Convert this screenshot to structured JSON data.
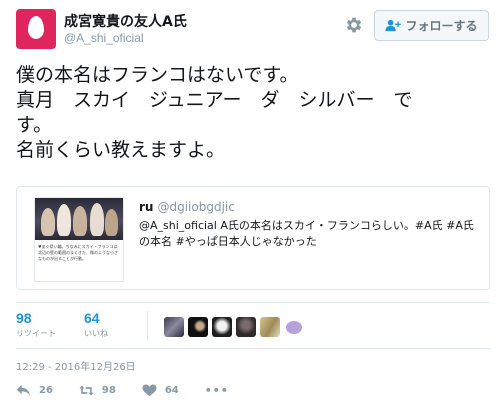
{
  "author": {
    "display_name": "成宮寛貴の友人A氏",
    "screen_name": "@A_shi_oficial",
    "avatar_color": "#e0245e"
  },
  "follow_button": {
    "label": "フォローする"
  },
  "tweet": {
    "lines": [
      "僕の本名はフランコはないです。",
      "真月　スカイ　ジュニアー　ダ　シルバー　で",
      "す。",
      "名前くらい教えますよ。"
    ]
  },
  "quoted_tweet": {
    "name": "ru",
    "handle": "@dgiiobgdjic",
    "text": "@A_shi_oficial A氏の本名はスカイ・フランコらしい。#A氏 #A氏の本名 #やっぱ日本人じゃなかった",
    "image_caption": "♥あぐ祭い輪。ちなみにスカイ・フランコは北辺の壁の範囲のまくきた、微のような小さなものが出ることが行動。"
  },
  "stats": {
    "retweets": {
      "count": "98",
      "label": "リツイート"
    },
    "likes": {
      "count": "64",
      "label": "いいね"
    }
  },
  "likers": [
    "liker-1",
    "liker-2",
    "liker-3",
    "liker-4",
    "liker-5",
    "liker-6"
  ],
  "timestamp": "12:29 - 2016年12月26日",
  "actions": {
    "reply_count": "26",
    "retweet_count": "98",
    "like_count": "64",
    "more_label": "•••"
  },
  "colors": {
    "link": "#1b95e0",
    "muted": "#8899a6",
    "border": "#e1e8ed"
  }
}
